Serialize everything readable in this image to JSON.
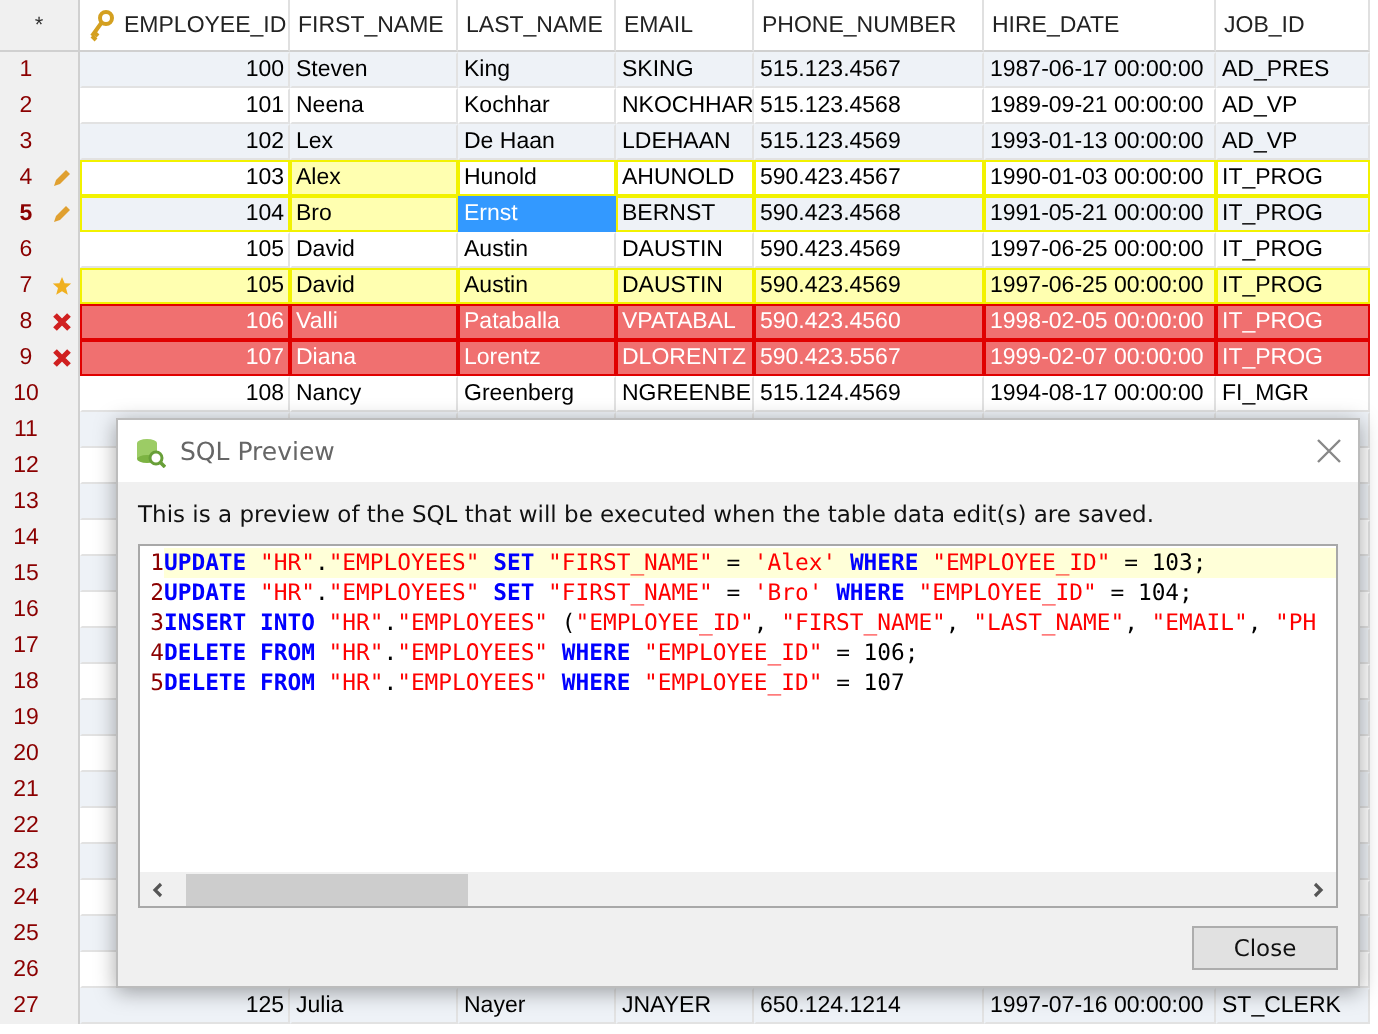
{
  "grid": {
    "corner": "*",
    "columns": [
      "EMPLOYEE_ID",
      "FIRST_NAME",
      "LAST_NAME",
      "EMAIL",
      "PHONE_NUMBER",
      "HIRE_DATE",
      "JOB_ID"
    ],
    "rows": [
      {
        "number": "1",
        "kind": "normal",
        "current": false,
        "cells": [
          {
            "text": "100",
            "modified": false,
            "selected": false
          },
          {
            "text": "Steven",
            "modified": false,
            "selected": false
          },
          {
            "text": "King",
            "modified": false,
            "selected": false
          },
          {
            "text": "SKING",
            "modified": false,
            "selected": false
          },
          {
            "text": "515.123.4567",
            "modified": false,
            "selected": false
          },
          {
            "text": "1987-06-17 00:00:00",
            "modified": false,
            "selected": false
          },
          {
            "text": "AD_PRES",
            "modified": false,
            "selected": false
          }
        ]
      },
      {
        "number": "2",
        "kind": "normal",
        "current": false,
        "cells": [
          {
            "text": "101",
            "modified": false,
            "selected": false
          },
          {
            "text": "Neena",
            "modified": false,
            "selected": false
          },
          {
            "text": "Kochhar",
            "modified": false,
            "selected": false
          },
          {
            "text": "NKOCHHAR",
            "modified": false,
            "selected": false
          },
          {
            "text": "515.123.4568",
            "modified": false,
            "selected": false
          },
          {
            "text": "1989-09-21 00:00:00",
            "modified": false,
            "selected": false
          },
          {
            "text": "AD_VP",
            "modified": false,
            "selected": false
          }
        ]
      },
      {
        "number": "3",
        "kind": "normal",
        "current": false,
        "cells": [
          {
            "text": "102",
            "modified": false,
            "selected": false
          },
          {
            "text": "Lex",
            "modified": false,
            "selected": false
          },
          {
            "text": "De Haan",
            "modified": false,
            "selected": false
          },
          {
            "text": "LDEHAAN",
            "modified": false,
            "selected": false
          },
          {
            "text": "515.123.4569",
            "modified": false,
            "selected": false
          },
          {
            "text": "1993-01-13 00:00:00",
            "modified": false,
            "selected": false
          },
          {
            "text": "AD_VP",
            "modified": false,
            "selected": false
          }
        ]
      },
      {
        "number": "4",
        "kind": "updated",
        "current": false,
        "cells": [
          {
            "text": "103",
            "modified": false,
            "selected": false
          },
          {
            "text": "Alex",
            "modified": true,
            "selected": false
          },
          {
            "text": "Hunold",
            "modified": false,
            "selected": false
          },
          {
            "text": "AHUNOLD",
            "modified": false,
            "selected": false
          },
          {
            "text": "590.423.4567",
            "modified": false,
            "selected": false
          },
          {
            "text": "1990-01-03 00:00:00",
            "modified": false,
            "selected": false
          },
          {
            "text": "IT_PROG",
            "modified": false,
            "selected": false
          }
        ]
      },
      {
        "number": "5",
        "kind": "updated",
        "current": true,
        "cells": [
          {
            "text": "104",
            "modified": false,
            "selected": false
          },
          {
            "text": "Bro",
            "modified": true,
            "selected": false
          },
          {
            "text": "Ernst",
            "modified": false,
            "selected": true
          },
          {
            "text": "BERNST",
            "modified": false,
            "selected": false
          },
          {
            "text": "590.423.4568",
            "modified": false,
            "selected": false
          },
          {
            "text": "1991-05-21 00:00:00",
            "modified": false,
            "selected": false
          },
          {
            "text": "IT_PROG",
            "modified": false,
            "selected": false
          }
        ]
      },
      {
        "number": "6",
        "kind": "normal",
        "current": false,
        "cells": [
          {
            "text": "105",
            "modified": false,
            "selected": false
          },
          {
            "text": "David",
            "modified": false,
            "selected": false
          },
          {
            "text": "Austin",
            "modified": false,
            "selected": false
          },
          {
            "text": "DAUSTIN",
            "modified": false,
            "selected": false
          },
          {
            "text": "590.423.4569",
            "modified": false,
            "selected": false
          },
          {
            "text": "1997-06-25 00:00:00",
            "modified": false,
            "selected": false
          },
          {
            "text": "IT_PROG",
            "modified": false,
            "selected": false
          }
        ]
      },
      {
        "number": "7",
        "kind": "inserted",
        "current": false,
        "cells": [
          {
            "text": "105",
            "selected": false
          },
          {
            "text": "David",
            "selected": false
          },
          {
            "text": "Austin",
            "selected": false
          },
          {
            "text": "DAUSTIN",
            "selected": false
          },
          {
            "text": "590.423.4569",
            "selected": false
          },
          {
            "text": "1997-06-25 00:00:00",
            "selected": false
          },
          {
            "text": "IT_PROG",
            "selected": false
          }
        ]
      },
      {
        "number": "8",
        "kind": "deleted",
        "current": false,
        "cells": [
          {
            "text": "106",
            "modified": false,
            "selected": false
          },
          {
            "text": "Valli",
            "modified": false,
            "selected": false
          },
          {
            "text": "Pataballa",
            "modified": false,
            "selected": false
          },
          {
            "text": "VPATABAL",
            "modified": false,
            "selected": false
          },
          {
            "text": "590.423.4560",
            "modified": false,
            "selected": false
          },
          {
            "text": "1998-02-05 00:00:00",
            "modified": false,
            "selected": false
          },
          {
            "text": "IT_PROG",
            "modified": false,
            "selected": false
          }
        ]
      },
      {
        "number": "9",
        "kind": "deleted",
        "current": false,
        "cells": [
          {
            "text": "107",
            "modified": false,
            "selected": false
          },
          {
            "text": "Diana",
            "modified": false,
            "selected": false
          },
          {
            "text": "Lorentz",
            "modified": false,
            "selected": false
          },
          {
            "text": "DLORENTZ",
            "modified": false,
            "selected": false
          },
          {
            "text": "590.423.5567",
            "modified": false,
            "selected": false
          },
          {
            "text": "1999-02-07 00:00:00",
            "modified": false,
            "selected": false
          },
          {
            "text": "IT_PROG",
            "modified": false,
            "selected": false
          }
        ]
      },
      {
        "number": "10",
        "kind": "normal",
        "current": false,
        "cells": [
          {
            "text": "108",
            "modified": false,
            "selected": false
          },
          {
            "text": "Nancy",
            "modified": false,
            "selected": false
          },
          {
            "text": "Greenberg",
            "modified": false,
            "selected": false
          },
          {
            "text": "NGREENBE",
            "modified": false,
            "selected": false
          },
          {
            "text": "515.124.4569",
            "modified": false,
            "selected": false
          },
          {
            "text": "1994-08-17 00:00:00",
            "modified": false,
            "selected": false
          },
          {
            "text": "FI_MGR",
            "modified": false,
            "selected": false
          }
        ]
      },
      {
        "number": "11",
        "kind": "normal",
        "current": false
      },
      {
        "number": "12",
        "kind": "normal",
        "current": false
      },
      {
        "number": "13",
        "kind": "normal",
        "current": false
      },
      {
        "number": "14",
        "kind": "normal",
        "current": false
      },
      {
        "number": "15",
        "kind": "normal",
        "current": false
      },
      {
        "number": "16",
        "kind": "normal",
        "current": false
      },
      {
        "number": "17",
        "kind": "normal",
        "current": false
      },
      {
        "number": "18",
        "kind": "normal",
        "current": false
      },
      {
        "number": "19",
        "kind": "normal",
        "current": false
      },
      {
        "number": "20",
        "kind": "normal",
        "current": false
      },
      {
        "number": "21",
        "kind": "normal",
        "current": false
      },
      {
        "number": "22",
        "kind": "normal",
        "current": false
      },
      {
        "number": "23",
        "kind": "normal",
        "current": false
      },
      {
        "number": "24",
        "kind": "normal",
        "current": false
      },
      {
        "number": "25",
        "kind": "normal",
        "current": false
      },
      {
        "number": "26",
        "kind": "normal",
        "current": false
      },
      {
        "number": "27",
        "kind": "normal",
        "current": false,
        "cells": [
          {
            "text": "125",
            "modified": false,
            "selected": false
          },
          {
            "text": "Julia",
            "modified": false,
            "selected": false
          },
          {
            "text": "Nayer",
            "modified": false,
            "selected": false
          },
          {
            "text": "JNAYER",
            "modified": false,
            "selected": false
          },
          {
            "text": "650.124.1214",
            "modified": false,
            "selected": false
          },
          {
            "text": "1997-07-16 00:00:00",
            "modified": false,
            "selected": false
          },
          {
            "text": "ST_CLERK",
            "modified": false,
            "selected": false
          }
        ]
      }
    ]
  },
  "dialog": {
    "title": "SQL Preview",
    "description": "This is a preview of the SQL that will be executed when the table data edit(s) are saved.",
    "code_lines": [
      {
        "number": "1",
        "current": true,
        "tokens": [
          {
            "kind": "keyword",
            "text": "UPDATE "
          },
          {
            "kind": "string",
            "text": "\"HR\""
          },
          {
            "kind": "plain",
            "text": "."
          },
          {
            "kind": "string",
            "text": "\"EMPLOYEES\" "
          },
          {
            "kind": "keyword",
            "text": "SET "
          },
          {
            "kind": "string",
            "text": "\"FIRST_NAME\" "
          },
          {
            "kind": "plain",
            "text": "= "
          },
          {
            "kind": "string",
            "text": "'Alex' "
          },
          {
            "kind": "keyword",
            "text": "WHERE "
          },
          {
            "kind": "string",
            "text": "\"EMPLOYEE_ID\" "
          },
          {
            "kind": "plain",
            "text": "= 103;"
          }
        ]
      },
      {
        "number": "2",
        "current": false,
        "tokens": [
          {
            "kind": "keyword",
            "text": "UPDATE "
          },
          {
            "kind": "string",
            "text": "\"HR\""
          },
          {
            "kind": "plain",
            "text": "."
          },
          {
            "kind": "string",
            "text": "\"EMPLOYEES\" "
          },
          {
            "kind": "keyword",
            "text": "SET "
          },
          {
            "kind": "string",
            "text": "\"FIRST_NAME\" "
          },
          {
            "kind": "plain",
            "text": "= "
          },
          {
            "kind": "string",
            "text": "'Bro' "
          },
          {
            "kind": "keyword",
            "text": "WHERE "
          },
          {
            "kind": "string",
            "text": "\"EMPLOYEE_ID\" "
          },
          {
            "kind": "plain",
            "text": "= 104;"
          }
        ]
      },
      {
        "number": "3",
        "current": false,
        "tokens": [
          {
            "kind": "keyword",
            "text": "INSERT INTO "
          },
          {
            "kind": "string",
            "text": "\"HR\""
          },
          {
            "kind": "plain",
            "text": "."
          },
          {
            "kind": "string",
            "text": "\"EMPLOYEES\" "
          },
          {
            "kind": "plain",
            "text": "("
          },
          {
            "kind": "string",
            "text": "\"EMPLOYEE_ID\""
          },
          {
            "kind": "plain",
            "text": ", "
          },
          {
            "kind": "string",
            "text": "\"FIRST_NAME\""
          },
          {
            "kind": "plain",
            "text": ", "
          },
          {
            "kind": "string",
            "text": "\"LAST_NAME\""
          },
          {
            "kind": "plain",
            "text": ", "
          },
          {
            "kind": "string",
            "text": "\"EMAIL\""
          },
          {
            "kind": "plain",
            "text": ", "
          },
          {
            "kind": "string",
            "text": "\"PH"
          }
        ]
      },
      {
        "number": "4",
        "current": false,
        "tokens": [
          {
            "kind": "keyword",
            "text": "DELETE FROM "
          },
          {
            "kind": "string",
            "text": "\"HR\""
          },
          {
            "kind": "plain",
            "text": "."
          },
          {
            "kind": "string",
            "text": "\"EMPLOYEES\" "
          },
          {
            "kind": "keyword",
            "text": "WHERE "
          },
          {
            "kind": "string",
            "text": "\"EMPLOYEE_ID\" "
          },
          {
            "kind": "plain",
            "text": "= 106;"
          }
        ]
      },
      {
        "number": "5",
        "current": false,
        "tokens": [
          {
            "kind": "keyword",
            "text": "DELETE FROM "
          },
          {
            "kind": "string",
            "text": "\"HR\""
          },
          {
            "kind": "plain",
            "text": "."
          },
          {
            "kind": "string",
            "text": "\"EMPLOYEES\" "
          },
          {
            "kind": "keyword",
            "text": "WHERE "
          },
          {
            "kind": "string",
            "text": "\"EMPLOYEE_ID\" "
          },
          {
            "kind": "plain",
            "text": "= 107"
          }
        ]
      }
    ],
    "buttons": [
      "Close"
    ]
  }
}
